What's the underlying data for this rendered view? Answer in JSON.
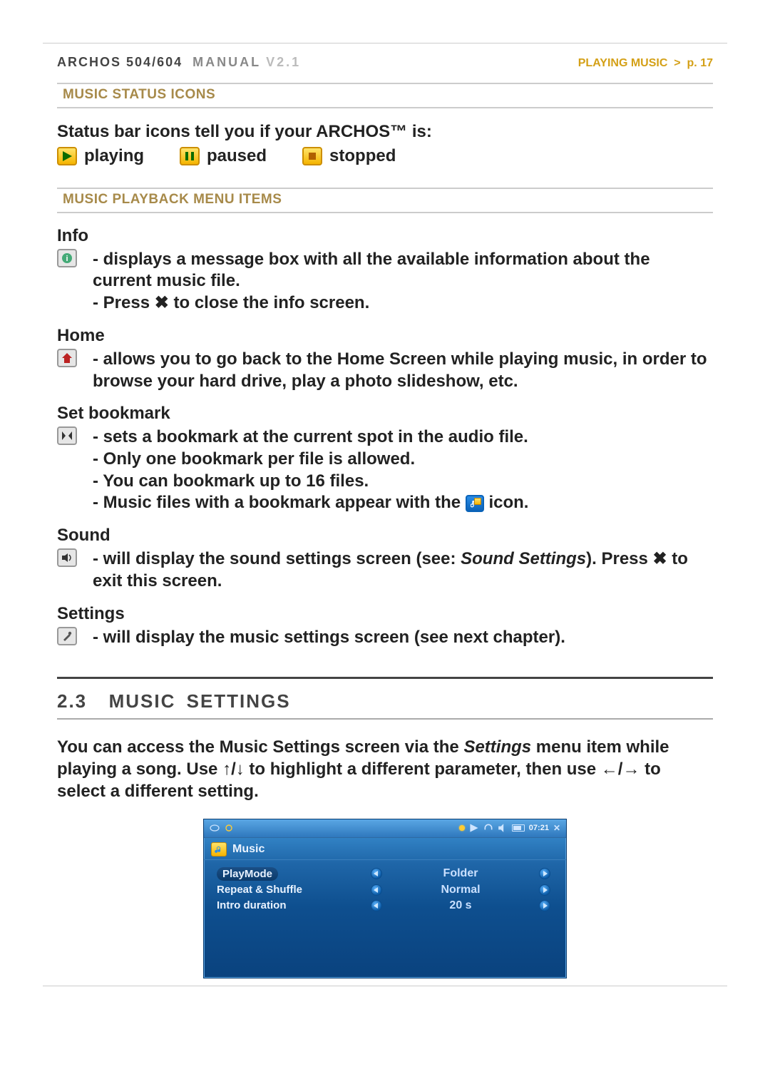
{
  "header": {
    "brand": "ARCHOS",
    "model": "504/604",
    "manual_word": "MANUAL",
    "version": "V2.1",
    "page_section": "PLAYING MUSIC",
    "page_sep": ">",
    "page_num": "p. 17"
  },
  "sections": {
    "status_icons": "MUSIC STATUS ICONS",
    "playback_menu": "MUSIC PLAYBACK MENU ITEMS"
  },
  "status": {
    "heading": "Status bar icons tell you if your ARCHOS™ is:",
    "playing": "playing",
    "paused": "paused",
    "stopped": "stopped"
  },
  "menu": {
    "info": {
      "title": "Info",
      "l1": "displays a message box with all the available information about the current music file.",
      "l2a": "Press ",
      "l2b": " to close the info screen."
    },
    "home": {
      "title": "Home",
      "l1": "allows you to go back to the Home Screen while playing music, in order to browse your hard drive, play a photo slideshow, etc."
    },
    "bookmark": {
      "title": "Set bookmark",
      "l1": "sets a bookmark at the current spot in the audio file.",
      "l2": "Only one bookmark per file is allowed.",
      "l3": "You can bookmark up to 16 files.",
      "l4": "Music files with a bookmark appear with the ",
      "l4b": " icon."
    },
    "sound": {
      "title": "Sound",
      "l1a": "will display the sound settings screen (see: ",
      "l1b": "Sound Settings",
      "l1c": "). Press ",
      "l1d": " to exit this screen."
    },
    "settings": {
      "title": "Settings",
      "l1": "will display the music settings screen (see next chapter)."
    }
  },
  "chapter": {
    "num": "2.3",
    "title": "Music Settings"
  },
  "para": {
    "t1": "You can access the Music Settings screen via the ",
    "t2": "Settings",
    "t3": " menu item while playing a song. Use ",
    "t4": " to highlight a different parameter, then use ",
    "t5": " to select a different setting."
  },
  "screen": {
    "clock": "07:21",
    "tab": "Music",
    "rows": [
      {
        "label": "PlayMode",
        "value": "Folder"
      },
      {
        "label": "Repeat & Shuffle",
        "value": "Normal"
      },
      {
        "label": "Intro duration",
        "value": "20 s"
      }
    ]
  },
  "symbols": {
    "x": "✖",
    "up": "↑",
    "down": "↓",
    "left": "←",
    "right": "→",
    "slash": "/"
  }
}
